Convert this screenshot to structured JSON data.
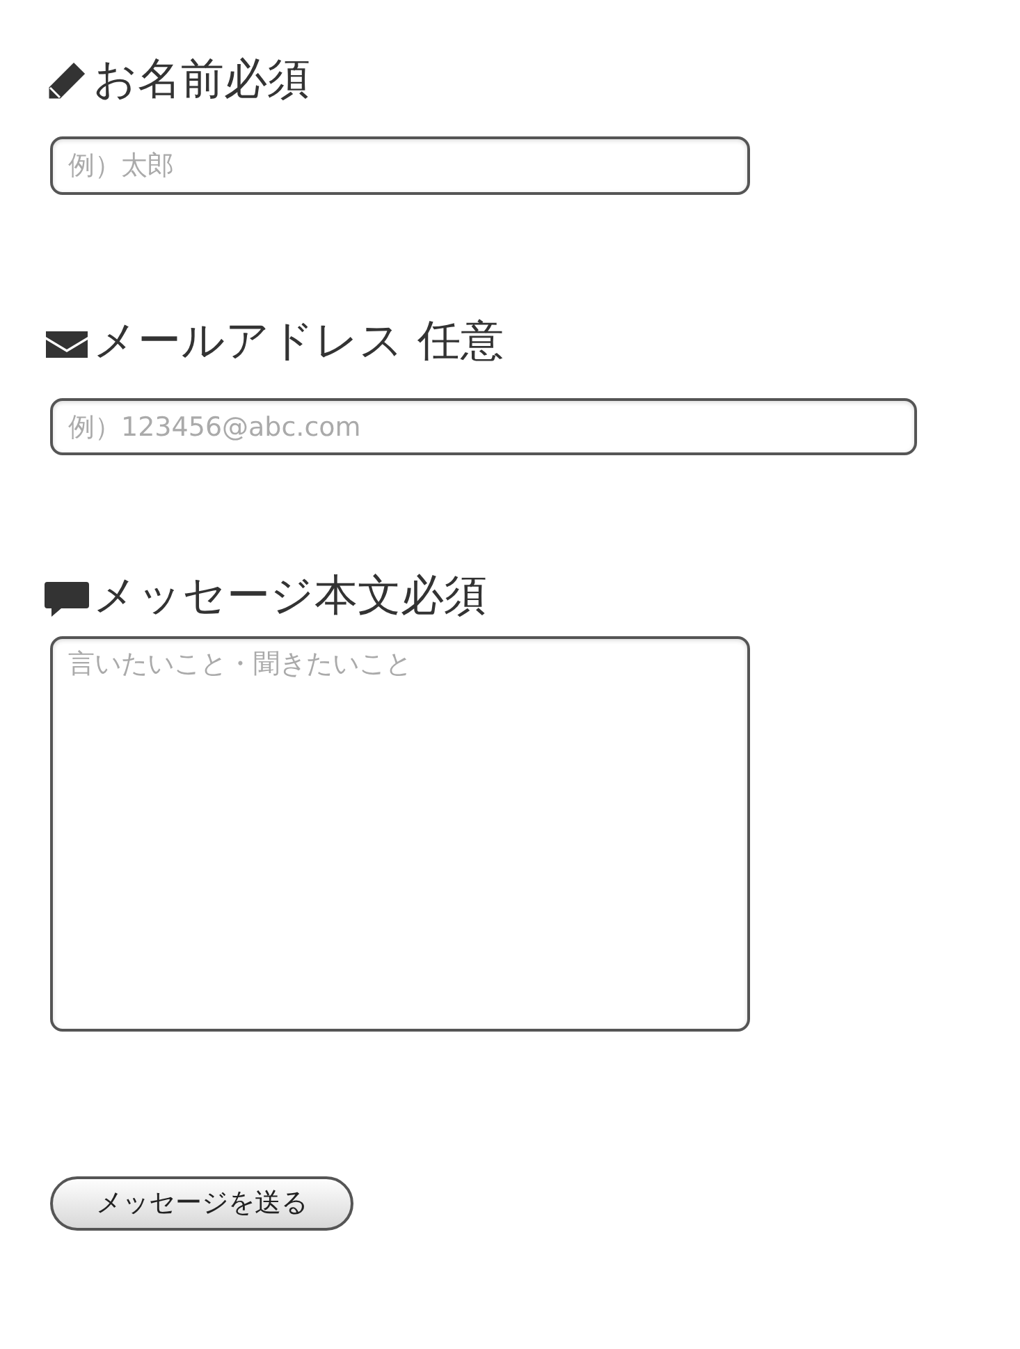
{
  "fields": [
    {
      "kind": "text",
      "label": "お名前必須",
      "placeholder": "例）太郎"
    },
    {
      "kind": "email",
      "label": "メールアドレス 任意",
      "placeholder": "例）123456@abc.com"
    },
    {
      "kind": "textarea",
      "label": "メッセージ本文必須",
      "placeholder": "言いたいこと・聞きたいこと"
    }
  ],
  "submit": {
    "label": "メッセージを送る"
  }
}
